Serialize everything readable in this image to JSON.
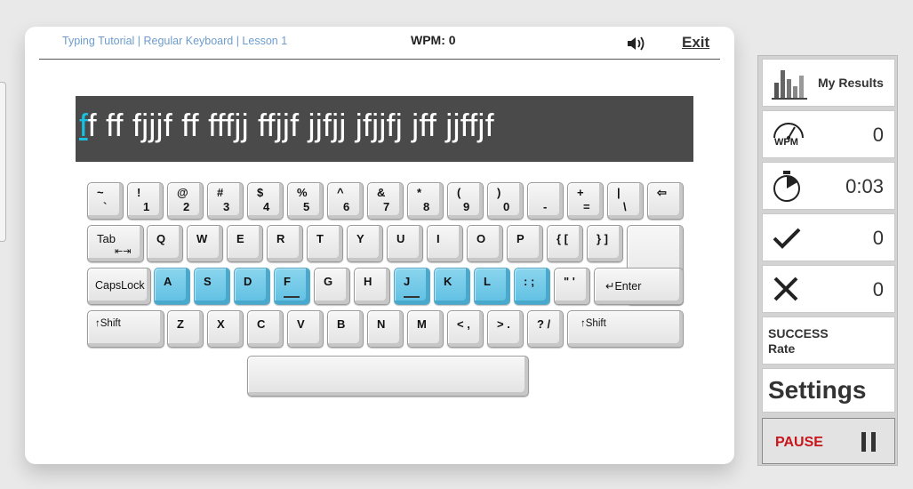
{
  "header": {
    "breadcrumb": "Typing Tutorial | Regular Keyboard | Lesson 1",
    "wpm_label": "WPM: 0",
    "exit_label": "Exit"
  },
  "lesson": {
    "current_char": "f",
    "remaining_text": "f ff fjjjf ff fffjj ffjjf jjfjj jfjjfj jff jjffjf"
  },
  "keyboard": {
    "number_row": [
      {
        "top": "~",
        "bottom": "`"
      },
      {
        "top": "!",
        "bottom": "1"
      },
      {
        "top": "@",
        "bottom": "2"
      },
      {
        "top": "#",
        "bottom": "3"
      },
      {
        "top": "$",
        "bottom": "4"
      },
      {
        "top": "%",
        "bottom": "5"
      },
      {
        "top": "^",
        "bottom": "6"
      },
      {
        "top": "&",
        "bottom": "7"
      },
      {
        "top": "*",
        "bottom": "8"
      },
      {
        "top": "(",
        "bottom": "9"
      },
      {
        "top": ")",
        "bottom": "0"
      },
      {
        "top": "",
        "bottom": "-"
      },
      {
        "top": "+",
        "bottom": "="
      },
      {
        "top": "|",
        "bottom": "\\"
      },
      {
        "top": "⇦",
        "bottom": ""
      }
    ],
    "top_row": [
      "Tab",
      "Q",
      "W",
      "E",
      "R",
      "T",
      "Y",
      "U",
      "I",
      "O",
      "P",
      "{ [",
      "} ]"
    ],
    "tab_sublabel": "⇤⇥",
    "home_row": [
      "CapsLock",
      "A",
      "S",
      "D",
      "F",
      "G",
      "H",
      "J",
      "K",
      "L",
      ": ;",
      "\" '",
      "↵Enter"
    ],
    "bottom_row": [
      "↑Shift",
      "Z",
      "X",
      "C",
      "V",
      "B",
      "N",
      "M",
      "< ,",
      "> .",
      "? /",
      "↑Shift"
    ],
    "highlighted_keys": [
      "A",
      "S",
      "D",
      "F",
      "J",
      "K",
      "L",
      ";"
    ],
    "highlight_color": "#5fbfe2"
  },
  "sidebar": {
    "my_results_label": "My Results",
    "wpm_icon_label": "WPM",
    "wpm_value": "0",
    "time_value": "0:03",
    "correct_value": "0",
    "errors_value": "0",
    "success_rate_label": "SUCCESS\nRate",
    "settings_label": "Settings",
    "pause_label": "PAUSE",
    "pause_color": "#c8161d"
  }
}
